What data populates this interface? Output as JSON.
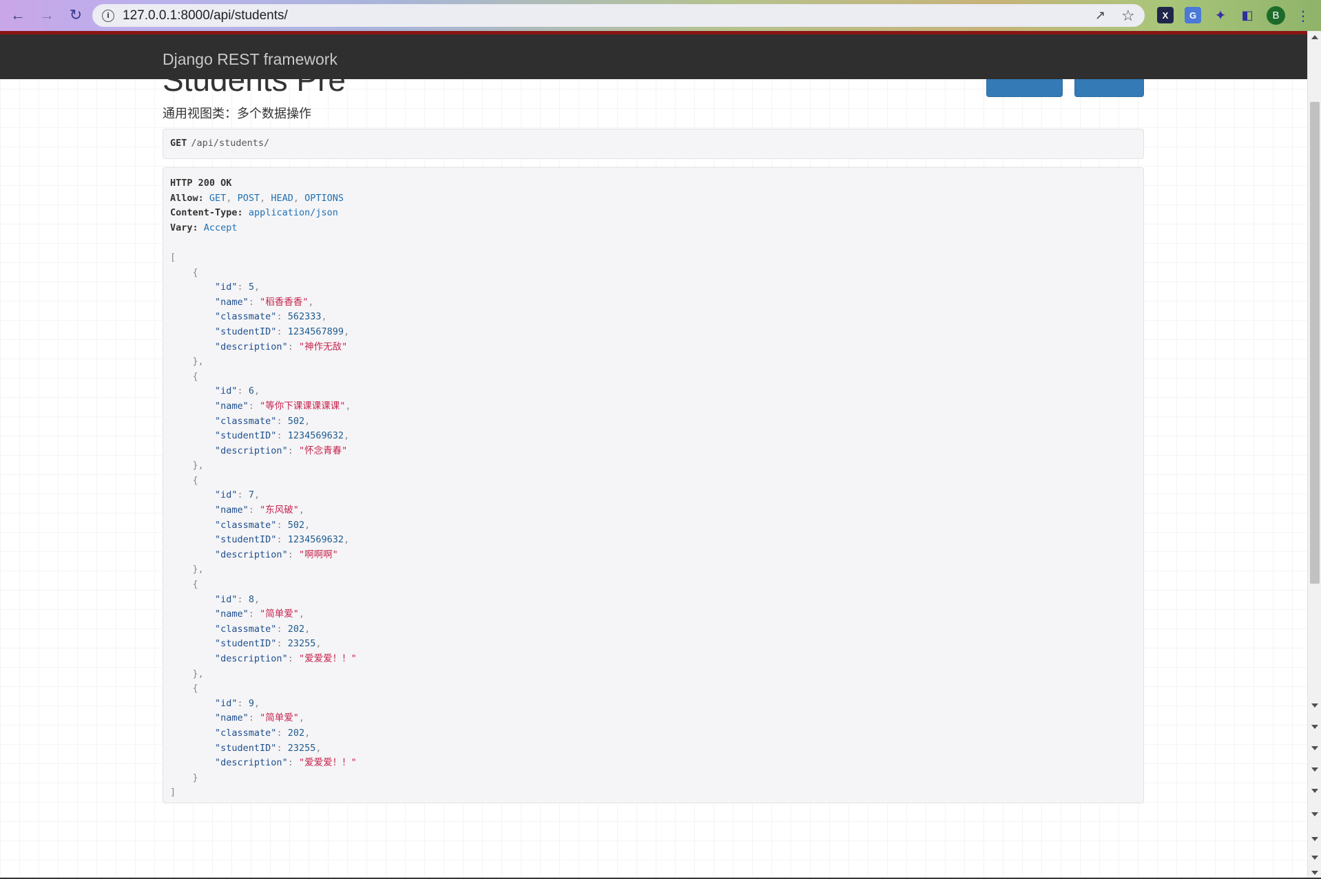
{
  "browser": {
    "url": "127.0.0.1:8000/api/students/",
    "avatar_letter": "B",
    "extensions": [
      "x-extension-icon",
      "google-translate-icon",
      "puzzle-icon",
      "sidebar-icon"
    ]
  },
  "navbar": {
    "brand": "Django REST framework",
    "accent_color": "#8a1414",
    "bg_color": "#2f2f2f"
  },
  "page": {
    "title": "Students Pre",
    "description": "通用视图类：多个数据操作",
    "request": {
      "method": "GET",
      "path": "/api/students/"
    },
    "response": {
      "status": "HTTP 200 OK",
      "headers": [
        {
          "key": "Allow:",
          "value": "GET, POST, HEAD, OPTIONS"
        },
        {
          "key": "Content-Type:",
          "value": "application/json"
        },
        {
          "key": "Vary:",
          "value": "Accept"
        }
      ],
      "body": [
        {
          "id": 5,
          "name": "稻香香香",
          "classmate": 562333,
          "studentID": 1234567899,
          "description": "神作无敌"
        },
        {
          "id": 6,
          "name": "等你下课课课课课",
          "classmate": 502,
          "studentID": 1234569632,
          "description": "怀念青春"
        },
        {
          "id": 7,
          "name": "东风破",
          "classmate": 502,
          "studentID": 1234569632,
          "description": "啊啊啊"
        },
        {
          "id": 8,
          "name": "简单爱",
          "classmate": 202,
          "studentID": 23255,
          "description": "爱爱爱！！"
        },
        {
          "id": 9,
          "name": "简单爱",
          "classmate": 202,
          "studentID": 23255,
          "description": "爱爱爱！！"
        }
      ]
    }
  }
}
